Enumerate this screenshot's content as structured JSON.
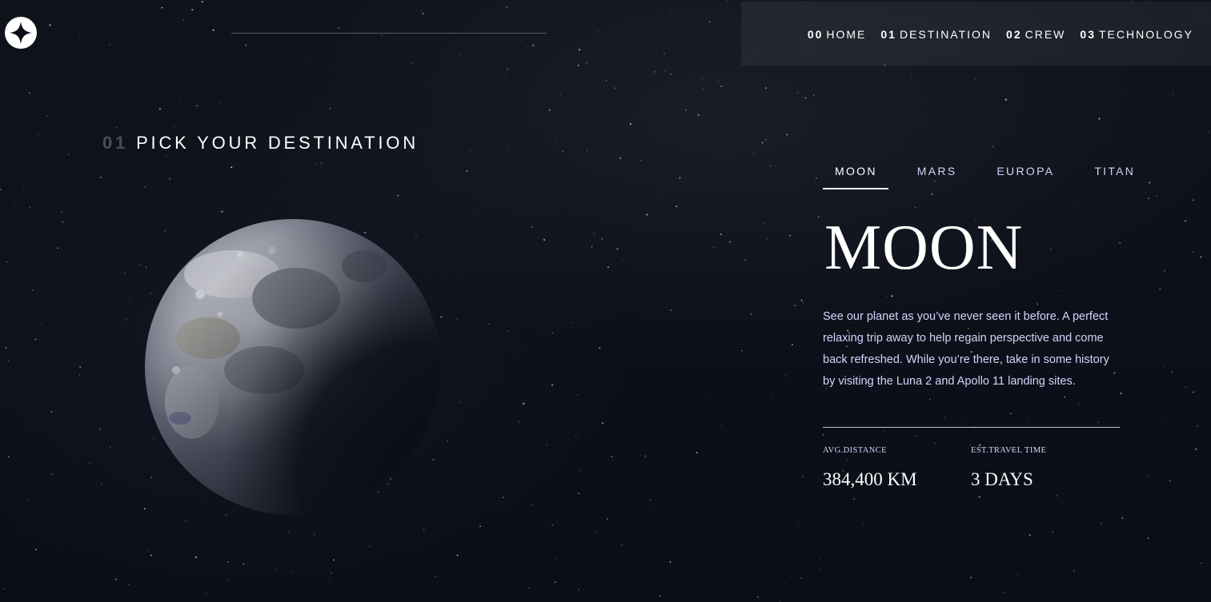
{
  "header": {
    "logo_icon": "star-logo-icon",
    "nav": [
      {
        "num": "00",
        "label": "HOME"
      },
      {
        "num": "01",
        "label": "DESTINATION"
      },
      {
        "num": "02",
        "label": "CREW"
      },
      {
        "num": "03",
        "label": "TECHNOLOGY"
      }
    ]
  },
  "page": {
    "heading_num": "01",
    "heading": "PICK YOUR DESTINATION",
    "image": "moon-image"
  },
  "tabs": [
    {
      "label": "MOON",
      "active": true
    },
    {
      "label": "MARS",
      "active": false
    },
    {
      "label": "EUROPA",
      "active": false
    },
    {
      "label": "TITAN",
      "active": false
    }
  ],
  "destination": {
    "name": "MOON",
    "description": "See our planet as you’ve never seen it before. A perfect relaxing trip away to help regain perspective and come back refreshed. While you’re there, take in some history by visiting the Luna 2 and Apollo 11 landing sites.",
    "distance_label": "AVG.DISTANCE",
    "distance_value": "384,400 KM",
    "travel_label": "EST.TRAVEL TIME",
    "travel_value": "3 DAYS"
  },
  "colors": {
    "background": "#0b0d17",
    "accent_text": "#d0d6f9",
    "white": "#ffffff"
  }
}
